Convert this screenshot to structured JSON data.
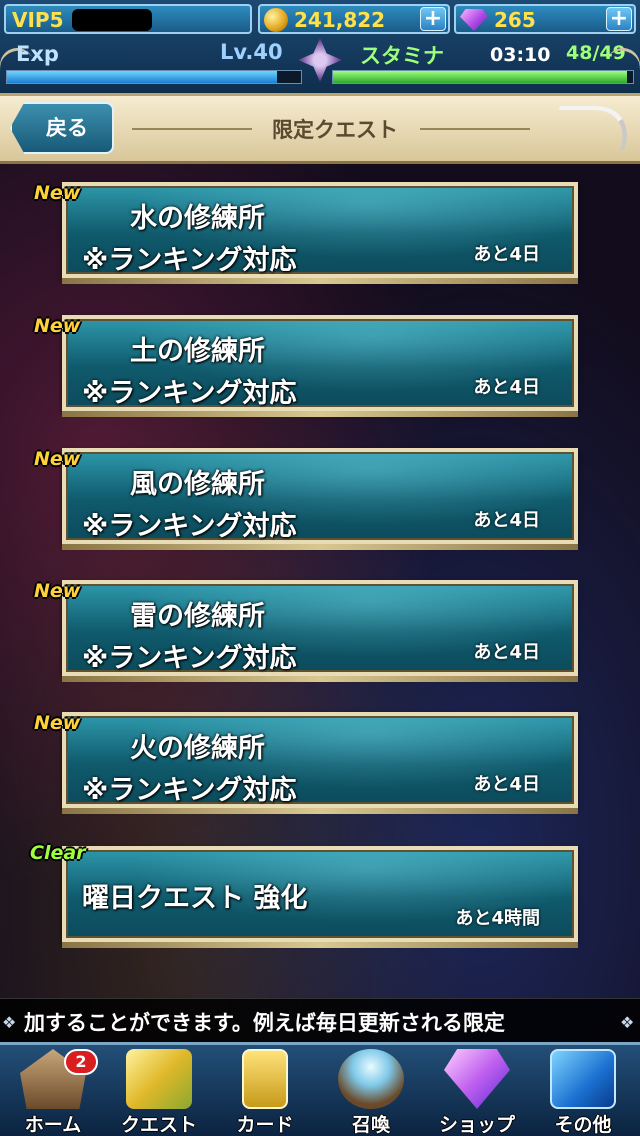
{
  "status_bar": {
    "vip_label": "VIP5",
    "coins": "241,822",
    "gems": "265",
    "plus_glyph": "+",
    "exp_label": "Exp",
    "level": "Lv.40",
    "stamina_label": "スタミナ",
    "stamina_timer": "03:10",
    "stamina_value": "48/49",
    "exp_fraction": 0.92,
    "stamina_fraction": 0.98
  },
  "header": {
    "back_label": "戻る",
    "title": "限定クエスト"
  },
  "quests": [
    {
      "badge": "New",
      "name": "水の修練所",
      "sub": "※ランキング対応",
      "time": "あと4日"
    },
    {
      "badge": "New",
      "name": "土の修練所",
      "sub": "※ランキング対応",
      "time": "あと4日"
    },
    {
      "badge": "New",
      "name": "風の修練所",
      "sub": "※ランキング対応",
      "time": "あと4日"
    },
    {
      "badge": "New",
      "name": "雷の修練所",
      "sub": "※ランキング対応",
      "time": "あと4日"
    },
    {
      "badge": "New",
      "name": "火の修練所",
      "sub": "※ランキング対応",
      "time": "あと4日"
    },
    {
      "badge": "Clear",
      "name": "曜日クエスト 強化",
      "time": "あと4時間"
    }
  ],
  "ticker": {
    "text": "加することができます。例えば毎日更新される限定"
  },
  "nav": {
    "home": "ホーム",
    "home_badge": "2",
    "quest": "クエスト",
    "card": "カード",
    "summon": "召喚",
    "shop": "ショップ",
    "other": "その他"
  },
  "colors": {
    "badge_new": "#ffd23a",
    "badge_clear": "#9fff3a",
    "currency": "#ffe14a",
    "stamina": "#9dff7a"
  }
}
